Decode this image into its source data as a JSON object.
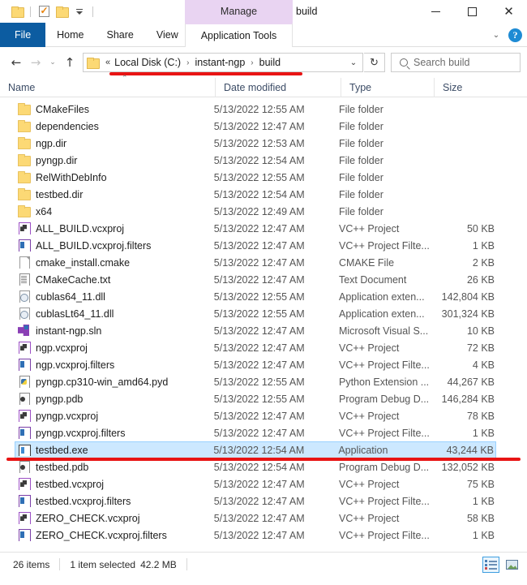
{
  "window": {
    "title": "build",
    "manage_tab_label": "Manage",
    "manage_tab_color": "#e9d4f2",
    "minimize_label": "",
    "maximize_label": "",
    "close_label": "✕"
  },
  "quick_access": {
    "folder_icon": "folder-icon",
    "properties_icon": "properties-checkmark-icon",
    "new_folder_icon": "new-folder-icon",
    "customize_icon": "chevron-down-icon"
  },
  "ribbon": {
    "tabs": [
      {
        "label": "File",
        "active": false,
        "is_file": true
      },
      {
        "label": "Home",
        "active": false,
        "is_file": false
      },
      {
        "label": "Share",
        "active": false,
        "is_file": false
      },
      {
        "label": "View",
        "active": false,
        "is_file": false
      }
    ],
    "contextual_tab": {
      "label": "Application Tools",
      "active": true
    },
    "collapse_icon": "chevron-down-icon",
    "help_label": "?",
    "help_color": "#1e8bd4"
  },
  "address_bar": {
    "back_icon": "back-arrow-icon",
    "forward_icon": "forward-arrow-icon",
    "recent_icon": "recent-locations-chevron-icon",
    "up_icon": "up-arrow-icon",
    "folder_icon": "folder-icon",
    "overflow": "«",
    "crumbs": [
      "Local Disk (C:)",
      "instant-ngp",
      "build"
    ],
    "separator": "›",
    "dropdown_icon": "chevron-down-icon",
    "refresh_icon": "↻",
    "search_placeholder": "Search build",
    "search_icon": "search-icon"
  },
  "columns": {
    "name": "Name",
    "date_modified": "Date modified",
    "type": "Type",
    "size": "Size",
    "sort_caret": "⌃"
  },
  "files": [
    {
      "name": "CMakeFiles",
      "date": "5/13/2022 12:55 AM",
      "type": "File folder",
      "size": "",
      "icon": "folder",
      "selected": false
    },
    {
      "name": "dependencies",
      "date": "5/13/2022 12:47 AM",
      "type": "File folder",
      "size": "",
      "icon": "folder",
      "selected": false
    },
    {
      "name": "ngp.dir",
      "date": "5/13/2022 12:53 AM",
      "type": "File folder",
      "size": "",
      "icon": "folder",
      "selected": false
    },
    {
      "name": "pyngp.dir",
      "date": "5/13/2022 12:54 AM",
      "type": "File folder",
      "size": "",
      "icon": "folder",
      "selected": false
    },
    {
      "name": "RelWithDebInfo",
      "date": "5/13/2022 12:55 AM",
      "type": "File folder",
      "size": "",
      "icon": "folder",
      "selected": false
    },
    {
      "name": "testbed.dir",
      "date": "5/13/2022 12:54 AM",
      "type": "File folder",
      "size": "",
      "icon": "folder",
      "selected": false
    },
    {
      "name": "x64",
      "date": "5/13/2022 12:49 AM",
      "type": "File folder",
      "size": "",
      "icon": "folder",
      "selected": false
    },
    {
      "name": "ALL_BUILD.vcxproj",
      "date": "5/13/2022 12:47 AM",
      "type": "VC++ Project",
      "size": "50 KB",
      "icon": "vcx",
      "selected": false
    },
    {
      "name": "ALL_BUILD.vcxproj.filters",
      "date": "5/13/2022 12:47 AM",
      "type": "VC++ Project Filte...",
      "size": "1 KB",
      "icon": "filters",
      "selected": false
    },
    {
      "name": "cmake_install.cmake",
      "date": "5/13/2022 12:47 AM",
      "type": "CMAKE File",
      "size": "2 KB",
      "icon": "doc",
      "selected": false
    },
    {
      "name": "CMakeCache.txt",
      "date": "5/13/2022 12:47 AM",
      "type": "Text Document",
      "size": "26 KB",
      "icon": "txt",
      "selected": false
    },
    {
      "name": "cublas64_11.dll",
      "date": "5/13/2022 12:55 AM",
      "type": "Application exten...",
      "size": "142,804 KB",
      "icon": "dll",
      "selected": false
    },
    {
      "name": "cublasLt64_11.dll",
      "date": "5/13/2022 12:55 AM",
      "type": "Application exten...",
      "size": "301,324 KB",
      "icon": "dll",
      "selected": false
    },
    {
      "name": "instant-ngp.sln",
      "date": "5/13/2022 12:47 AM",
      "type": "Microsoft Visual S...",
      "size": "10 KB",
      "icon": "sln",
      "selected": false
    },
    {
      "name": "ngp.vcxproj",
      "date": "5/13/2022 12:47 AM",
      "type": "VC++ Project",
      "size": "72 KB",
      "icon": "vcx",
      "selected": false
    },
    {
      "name": "ngp.vcxproj.filters",
      "date": "5/13/2022 12:47 AM",
      "type": "VC++ Project Filte...",
      "size": "4 KB",
      "icon": "filters",
      "selected": false
    },
    {
      "name": "pyngp.cp310-win_amd64.pyd",
      "date": "5/13/2022 12:55 AM",
      "type": "Python Extension ...",
      "size": "44,267 KB",
      "icon": "pyd",
      "selected": false
    },
    {
      "name": "pyngp.pdb",
      "date": "5/13/2022 12:55 AM",
      "type": "Program Debug D...",
      "size": "146,284 KB",
      "icon": "pdb",
      "selected": false
    },
    {
      "name": "pyngp.vcxproj",
      "date": "5/13/2022 12:47 AM",
      "type": "VC++ Project",
      "size": "78 KB",
      "icon": "vcx",
      "selected": false
    },
    {
      "name": "pyngp.vcxproj.filters",
      "date": "5/13/2022 12:47 AM",
      "type": "VC++ Project Filte...",
      "size": "1 KB",
      "icon": "filters",
      "selected": false
    },
    {
      "name": "testbed.exe",
      "date": "5/13/2022 12:54 AM",
      "type": "Application",
      "size": "43,244 KB",
      "icon": "exe",
      "selected": true
    },
    {
      "name": "testbed.pdb",
      "date": "5/13/2022 12:54 AM",
      "type": "Program Debug D...",
      "size": "132,052 KB",
      "icon": "pdb",
      "selected": false
    },
    {
      "name": "testbed.vcxproj",
      "date": "5/13/2022 12:47 AM",
      "type": "VC++ Project",
      "size": "75 KB",
      "icon": "vcx",
      "selected": false
    },
    {
      "name": "testbed.vcxproj.filters",
      "date": "5/13/2022 12:47 AM",
      "type": "VC++ Project Filte...",
      "size": "1 KB",
      "icon": "filters",
      "selected": false
    },
    {
      "name": "ZERO_CHECK.vcxproj",
      "date": "5/13/2022 12:47 AM",
      "type": "VC++ Project",
      "size": "58 KB",
      "icon": "vcx",
      "selected": false
    },
    {
      "name": "ZERO_CHECK.vcxproj.filters",
      "date": "5/13/2022 12:47 AM",
      "type": "VC++ Project Filte...",
      "size": "1 KB",
      "icon": "filters",
      "selected": false
    }
  ],
  "status_bar": {
    "item_count": "26 items",
    "selection": "1 item selected",
    "selection_size": "42.2 MB",
    "details_view_icon": "details-view-icon",
    "large_icons_view_icon": "large-icons-view-icon",
    "active_view": "details"
  },
  "annotations": {
    "color": "#e81414",
    "address_underline": true,
    "selected_row_underline": true
  }
}
